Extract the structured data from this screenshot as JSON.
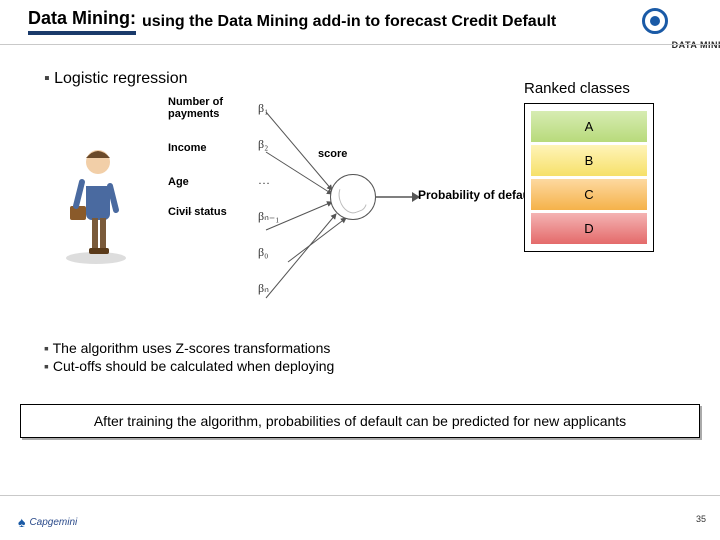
{
  "header": {
    "title_strong": "Data Mining:",
    "title_rest": "using the Data Mining add-in to forecast Credit Default",
    "brand_label": "DATA MININ"
  },
  "main_bullet": "Logistic regression",
  "inputs": {
    "label1": "Number of payments",
    "label2": "Income",
    "label3": "Age",
    "label4": "Civil status",
    "ellipsis": "…"
  },
  "betas": {
    "b1": "β₁",
    "b2": "β₂",
    "bdots": "…",
    "bn1": "βₙ₋₁",
    "b0": "β₀",
    "bn": "βₙ"
  },
  "score_label": "score",
  "output_label": "Probability of default",
  "ranked": {
    "title": "Ranked classes",
    "a": "A",
    "b": "B",
    "c": "C",
    "d": "D"
  },
  "sub_bullets": {
    "s1": "The algorithm uses Z-scores transformations",
    "s2": "Cut-offs should be calculated when deploying"
  },
  "callout": "After training the algorithm, probabilities of default can be predicted for new applicants",
  "footer": {
    "company": "Capgemini",
    "page": "35"
  }
}
